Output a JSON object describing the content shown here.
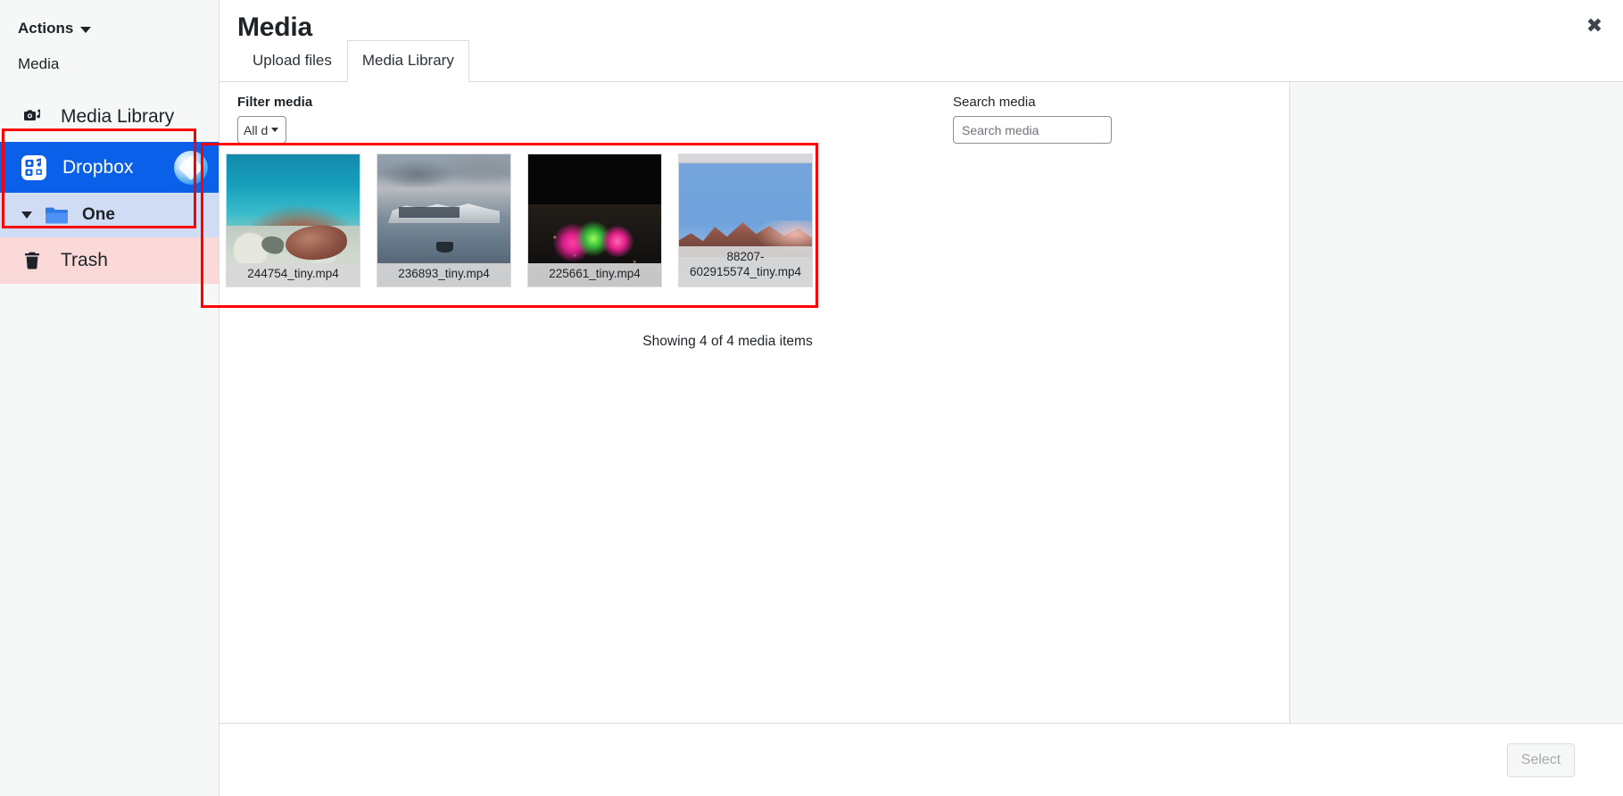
{
  "sidebar": {
    "actions_label": "Actions",
    "actions_icon": "chevron-down-icon",
    "section_label": "Media",
    "items": [
      {
        "label": "Media Library",
        "icon": "media-library-icon",
        "state": "default"
      },
      {
        "label": "Dropbox",
        "icon": "media-cloud-icon",
        "badge_icon": "dropbox-logo-icon",
        "state": "selected"
      },
      {
        "label": "One",
        "icon": "folder-icon",
        "toggle_icon": "caret-down-icon",
        "state": "expanded-child"
      },
      {
        "label": "Trash",
        "icon": "trash-icon",
        "state": "default"
      }
    ]
  },
  "modal": {
    "title": "Media",
    "close_icon": "close-icon",
    "close_label": "✖",
    "tabs": [
      {
        "label": "Upload files",
        "active": false
      },
      {
        "label": "Media Library",
        "active": true
      }
    ]
  },
  "toolbar": {
    "filter_label": "Filter media",
    "filter_value": "All d",
    "filter_caret_icon": "chevron-down-icon",
    "search_label": "Search media",
    "search_value": "",
    "search_placeholder": "Search media"
  },
  "grid": {
    "items": [
      {
        "filename": "244754_tiny.mp4",
        "art": "art-turtle",
        "name": "media-tile-sea-turtle"
      },
      {
        "filename": "236893_tiny.mp4",
        "art": "art-iceberg",
        "name": "media-tile-iceberg-boat"
      },
      {
        "filename": "225661_tiny.mp4",
        "art": "art-night",
        "name": "media-tile-night-fireworks"
      },
      {
        "filename": "88207-602915574_tiny.mp4",
        "art": "art-alpine",
        "name": "media-tile-alpine-mountain"
      }
    ],
    "status_text": "Showing 4 of 4 media items"
  },
  "footer": {
    "select_label": "Select",
    "select_disabled": true
  },
  "annotations": {
    "highlight_color": "#ff0000",
    "boxes": [
      {
        "name": "sidebar-dropbox-one-highlight"
      },
      {
        "name": "media-grid-highlight"
      }
    ]
  }
}
